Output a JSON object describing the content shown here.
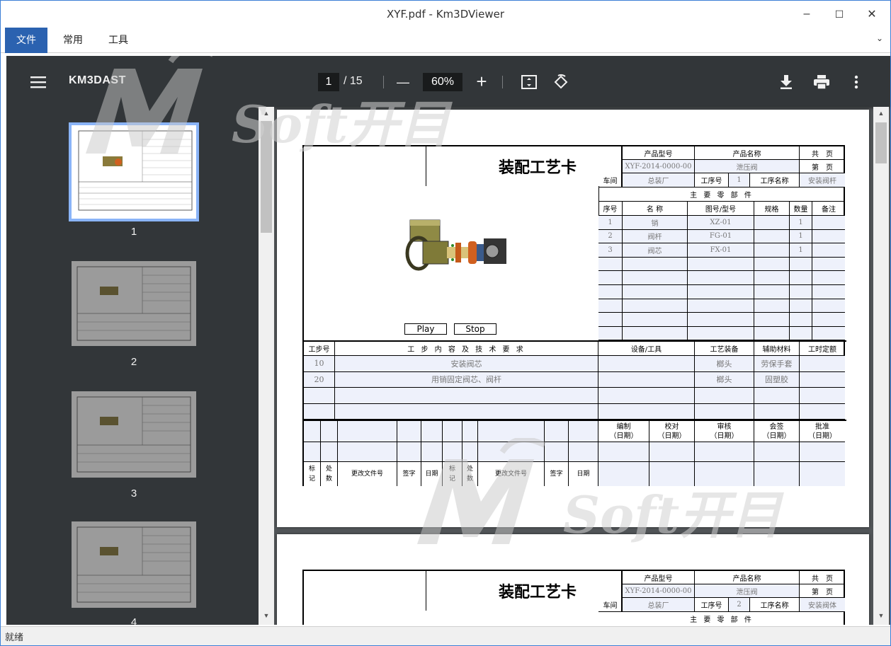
{
  "window": {
    "title": "XYF.pdf - Km3DViewer",
    "minimize": "–",
    "maximize": "☐",
    "close": "✕"
  },
  "menu": {
    "items": [
      "文件",
      "常用",
      "工具"
    ],
    "overflow": "⌄"
  },
  "toolbar": {
    "doc_title": "KM3DAST",
    "page_current": "1",
    "page_total": "/ 15",
    "zoom": "60%",
    "zoom_out": "—",
    "zoom_in": "+"
  },
  "thumbnails": [
    {
      "num": "1"
    },
    {
      "num": "2"
    },
    {
      "num": "3"
    },
    {
      "num": "4"
    }
  ],
  "card": {
    "title": "装配工艺卡",
    "header": {
      "product_model_label": "产品型号",
      "product_model": "XYF-2014-0000-00",
      "product_name_label": "产品名称",
      "product_name": "泄压阀",
      "total_label": "共　页",
      "page_label": "第　页",
      "workshop_label": "车间",
      "workshop": "总装厂",
      "process_no_label": "工序号",
      "process_no": "1",
      "process_name_label": "工序名称",
      "process_name": "安装阀杆"
    },
    "parts_title": "主 要 零 部 件",
    "parts_headers": [
      "序号",
      "名 称",
      "图号/型号",
      "规格",
      "数量",
      "备注"
    ],
    "parts": [
      [
        "1",
        "销",
        "XZ-01",
        "",
        "1",
        ""
      ],
      [
        "2",
        "阀杆",
        "FG-01",
        "",
        "1",
        ""
      ],
      [
        "3",
        "阀芯",
        "FX-01",
        "",
        "1",
        ""
      ]
    ],
    "play": "Play",
    "stop": "Stop",
    "step_headers": [
      "工步号",
      "工 步 内 容 及 技 术 要 求",
      "设备/工具",
      "工艺装备",
      "辅助材料",
      "工时定额"
    ],
    "steps": [
      [
        "10",
        "安装阀芯",
        "",
        "榔头",
        "劳保手套",
        ""
      ],
      [
        "20",
        "用销固定阀芯、阀杆",
        "",
        "榔头",
        "固塑胶",
        ""
      ]
    ],
    "sign_headers": [
      "编制\n（日期）",
      "校对\n（日期）",
      "审核\n（日期）",
      "会签\n（日期）",
      "批准\n（日期）"
    ],
    "rev_labels": [
      "标\n记",
      "处\n数",
      "更改文件号",
      "签字",
      "日期",
      "标\n记",
      "处\n数",
      "更改文件号",
      "签字",
      "日期"
    ]
  },
  "card2": {
    "product_model": "XYF-2014-0000-00",
    "product_name": "泄压阀",
    "workshop": "总装厂",
    "process_no": "2",
    "process_name": "安装阀体"
  },
  "watermark": {
    "brand": "Soft开目"
  },
  "status": {
    "text": "就绪"
  }
}
